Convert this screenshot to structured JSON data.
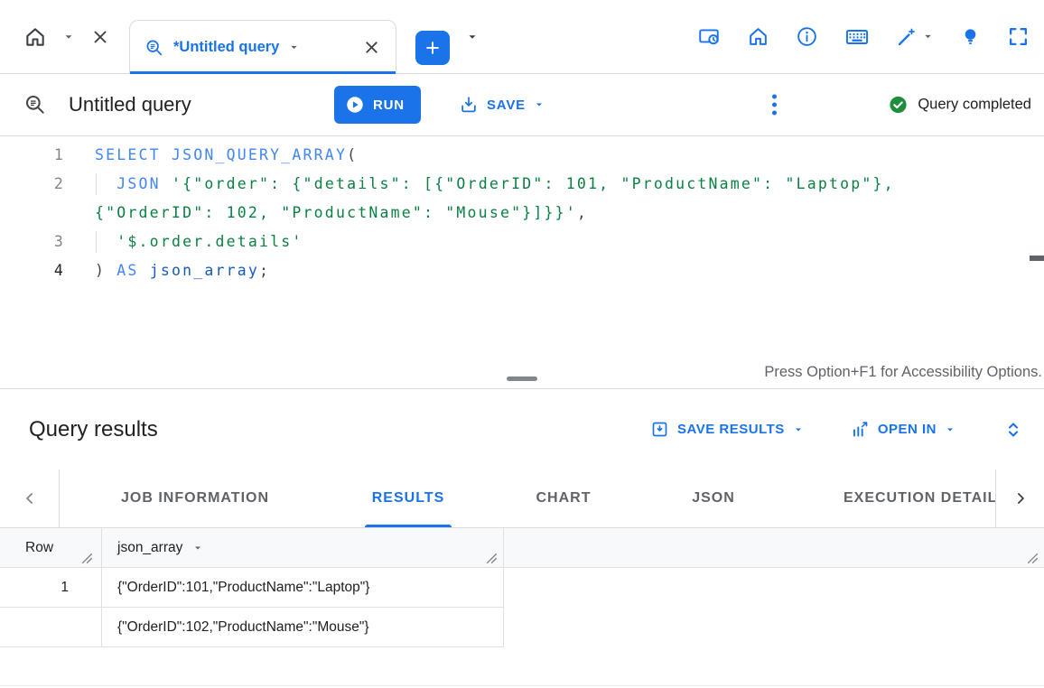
{
  "colors": {
    "accent": "#1a73e8",
    "status_green": "#1e8e3e",
    "keyword_blue": "#4285f4",
    "string_green": "#0b8043"
  },
  "icons": {
    "tab_left": [
      "home-icon",
      "caret-down-icon",
      "close-icon"
    ],
    "tab": [
      "query-magnifier-icon",
      "caret-down-icon",
      "close-icon"
    ],
    "tabstrip_right": [
      "add-tab-icon",
      "caret-down-icon",
      "console-clock-icon",
      "home-icon",
      "info-icon",
      "keyboard-icon",
      "magic-pen-icon",
      "caret-down-icon",
      "lightbulb-icon",
      "fullscreen-icon"
    ],
    "header": [
      "query-magnifier-icon",
      "play-circle-icon",
      "save-icon",
      "caret-down-icon",
      "kebab-menu-icon",
      "check-circle-icon"
    ],
    "results": [
      "save-results-icon",
      "caret-down-icon",
      "open-in-chart-icon",
      "caret-down-icon",
      "unfold-icon",
      "chevron-left-icon",
      "chevron-right-icon",
      "sort-caret-icon",
      "resize-handle-icon"
    ]
  },
  "tabstrip": {
    "tab_label": "*Untitled query"
  },
  "header": {
    "title": "Untitled query",
    "run_label": "RUN",
    "save_label": "SAVE",
    "status": "Query completed"
  },
  "editor": {
    "rows": [
      {
        "num": "1",
        "t0": "SELECT JSON_QUERY_ARRAY",
        "t1": "("
      },
      {
        "num": "2",
        "t0": "  ",
        "t1": "JSON ",
        "t2": "'{\"order\": {\"details\": [{\"OrderID\": 101, \"ProductName\": \"Laptop\"},"
      },
      {
        "num": "",
        "t0": "{\"OrderID\": 102, \"ProductName\": \"Mouse\"}]}}'",
        "t1": ","
      },
      {
        "num": "3",
        "t0": "  ",
        "t1": "'$.order.details'"
      },
      {
        "num": "4",
        "t0": ") ",
        "t1": "AS ",
        "t2": "json_array",
        "t3": ";"
      }
    ]
  },
  "divider": {
    "accessibility_hint": "Press Option+F1 for Accessibility Options."
  },
  "results": {
    "title": "Query results",
    "save_results_label": "SAVE RESULTS",
    "open_in_label": "OPEN IN",
    "tabs": [
      {
        "label": "JOB INFORMATION"
      },
      {
        "label": "RESULTS"
      },
      {
        "label": "CHART"
      },
      {
        "label": "JSON"
      },
      {
        "label": "EXECUTION DETAILS"
      }
    ],
    "table": {
      "row_header": "Row",
      "column_header": "json_array",
      "rows": [
        {
          "row": "1",
          "value": "{\"OrderID\":101,\"ProductName\":\"Laptop\"}"
        },
        {
          "row": "",
          "value": "{\"OrderID\":102,\"ProductName\":\"Mouse\"}"
        }
      ]
    }
  }
}
